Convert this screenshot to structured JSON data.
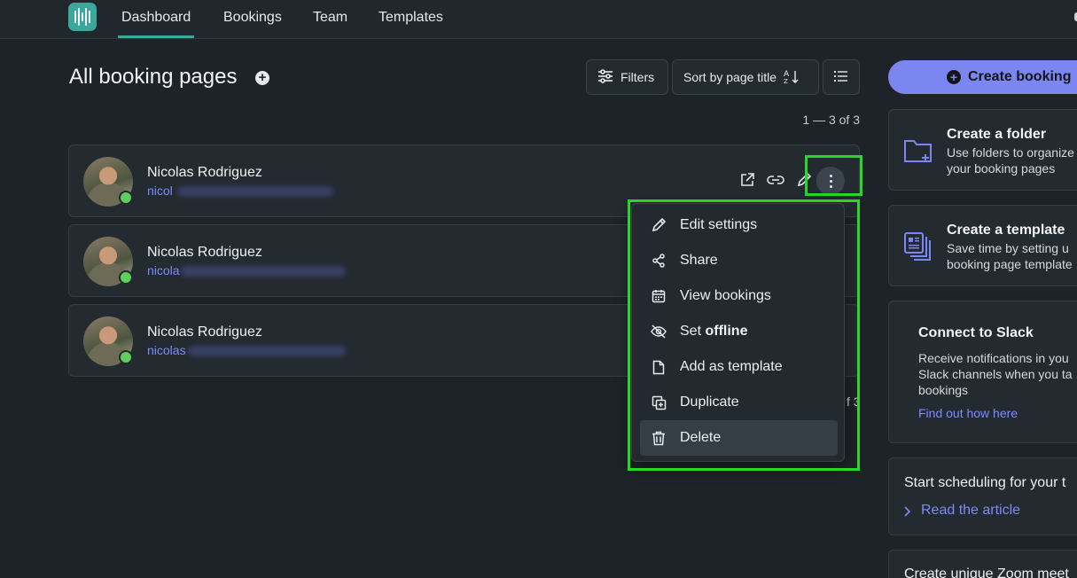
{
  "nav": {
    "items": [
      "Dashboard",
      "Bookings",
      "Team",
      "Templates"
    ],
    "active": "Dashboard"
  },
  "header": {
    "title": "All booking pages",
    "filters_label": "Filters",
    "sort_label": "Sort by page title",
    "sort_icon": "sort-alpha-icon",
    "view_icon": "list-view-icon",
    "range": "1 — 3 of 3"
  },
  "pages": [
    {
      "name": "Nicolas Rodriguez",
      "email_visible": "nicol",
      "status": "online"
    },
    {
      "name": "Nicolas Rodriguez",
      "email_visible": "nicola",
      "status": "online"
    },
    {
      "name": "Nicolas Rodriguez",
      "email_visible": "nicolas",
      "status": "online"
    }
  ],
  "row_actions": [
    "open-external-icon",
    "copy-link-icon",
    "edit-pencil-icon",
    "more-vertical-icon"
  ],
  "menu": {
    "items": [
      {
        "label": "Edit settings",
        "icon": "pencil-icon"
      },
      {
        "label": "Share",
        "icon": "share-icon"
      },
      {
        "label": "View bookings",
        "icon": "calendar-icon"
      },
      {
        "label_prefix": "Set ",
        "label_bold": "offline",
        "icon": "eye-off-icon"
      },
      {
        "label": "Add as template",
        "icon": "file-icon"
      },
      {
        "label": "Duplicate",
        "icon": "duplicate-icon"
      },
      {
        "label": "Delete",
        "icon": "trash-icon"
      }
    ],
    "hovered": "Delete"
  },
  "hidden_range_peek": "f 3",
  "sidebar": {
    "create_button": "Create booking",
    "folder": {
      "title": "Create a folder",
      "line1": "Use folders to organize",
      "line2": "your booking pages"
    },
    "template": {
      "title": "Create a template",
      "line1": "Save time by setting u",
      "line2": "booking page template"
    },
    "slack": {
      "title": "Connect to Slack",
      "line1": "Receive notifications in you",
      "line2": "Slack channels when you ta",
      "line3": "bookings",
      "link": "Find out how here"
    },
    "team": {
      "title": "Start scheduling for your t",
      "link": "Read the article"
    },
    "zoom": {
      "title": "Create unique Zoom meet"
    }
  },
  "colors": {
    "background": "#1d2329",
    "accent_teal": "#3aa89a",
    "accent_purple": "#7b86f0",
    "link": "#7c8bff",
    "online": "#5fce5a",
    "highlight": "#27d827"
  }
}
